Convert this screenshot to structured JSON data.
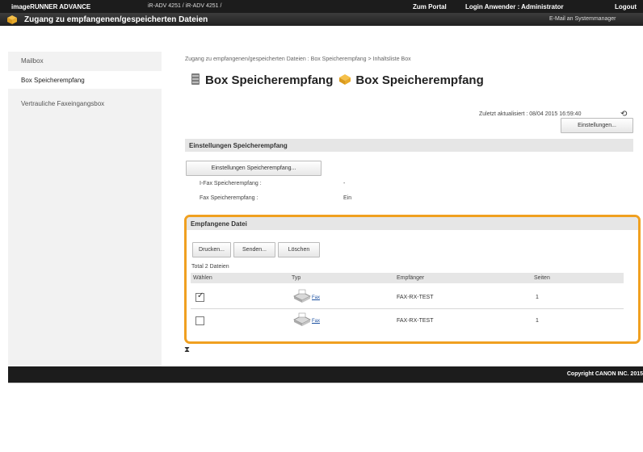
{
  "header": {
    "product": "imageRUNNER ADVANCE",
    "device": "iR-ADV 4251 / iR-ADV 4251 /",
    "portal_link": "Zum Portal",
    "login_user": "Login Anwender : Administrator",
    "logout": "Logout"
  },
  "titlebar": {
    "title": "Zugang zu empfangenen/gespeicherten Dateien",
    "mail_link": "E-Mail an Systemmanager"
  },
  "sidebar": {
    "items": [
      {
        "label": "Mailbox"
      },
      {
        "label": "Box Speicherempfang"
      },
      {
        "label": "Vertrauliche Faxeingangsbox"
      }
    ]
  },
  "main": {
    "breadcrumb": "Zugang zu empfangenen/gespeicherten Dateien : Box Speicherempfang > Inhaltsliste Box",
    "heading_part1": "Box Speicherempfang",
    "heading_part2": "Box Speicherempfang",
    "last_updated": "Zuletzt aktualisiert : 08/04 2015 16:59:40",
    "settings_button": "Einstellungen...",
    "settings_section": {
      "title": "Einstellungen Speicherempfang",
      "button": "Einstellungen Speicherempfang...",
      "rows": [
        {
          "label": "I-Fax Speicherempfang :",
          "value": "-"
        },
        {
          "label": "Fax Speicherempfang :",
          "value": "Ein"
        }
      ]
    },
    "received_files": {
      "title": "Empfangene Datei",
      "buttons": {
        "print": "Drucken...",
        "send": "Senden...",
        "delete": "Löschen"
      },
      "total": "Total 2 Dateien",
      "columns": [
        "Wählen",
        "Typ",
        "Empfänger",
        "Seiten"
      ],
      "rows": [
        {
          "checked": true,
          "type": "Fax",
          "recipient": "FAX-RX-TEST",
          "pages": "1"
        },
        {
          "checked": false,
          "type": "Fax",
          "recipient": "FAX-RX-TEST",
          "pages": "1"
        }
      ]
    }
  },
  "footer": {
    "copyright": "Copyright CANON INC. 2015"
  },
  "colors": {
    "highlight": "#f0a020",
    "topbar": "#1c1c1c",
    "link": "#1a4fa0"
  },
  "icons": {
    "title": "folder-arrow-icon",
    "box": "storage-box-icon",
    "refresh": "refresh-icon",
    "fax": "fax-icon",
    "collapse": "collapse-icon"
  }
}
